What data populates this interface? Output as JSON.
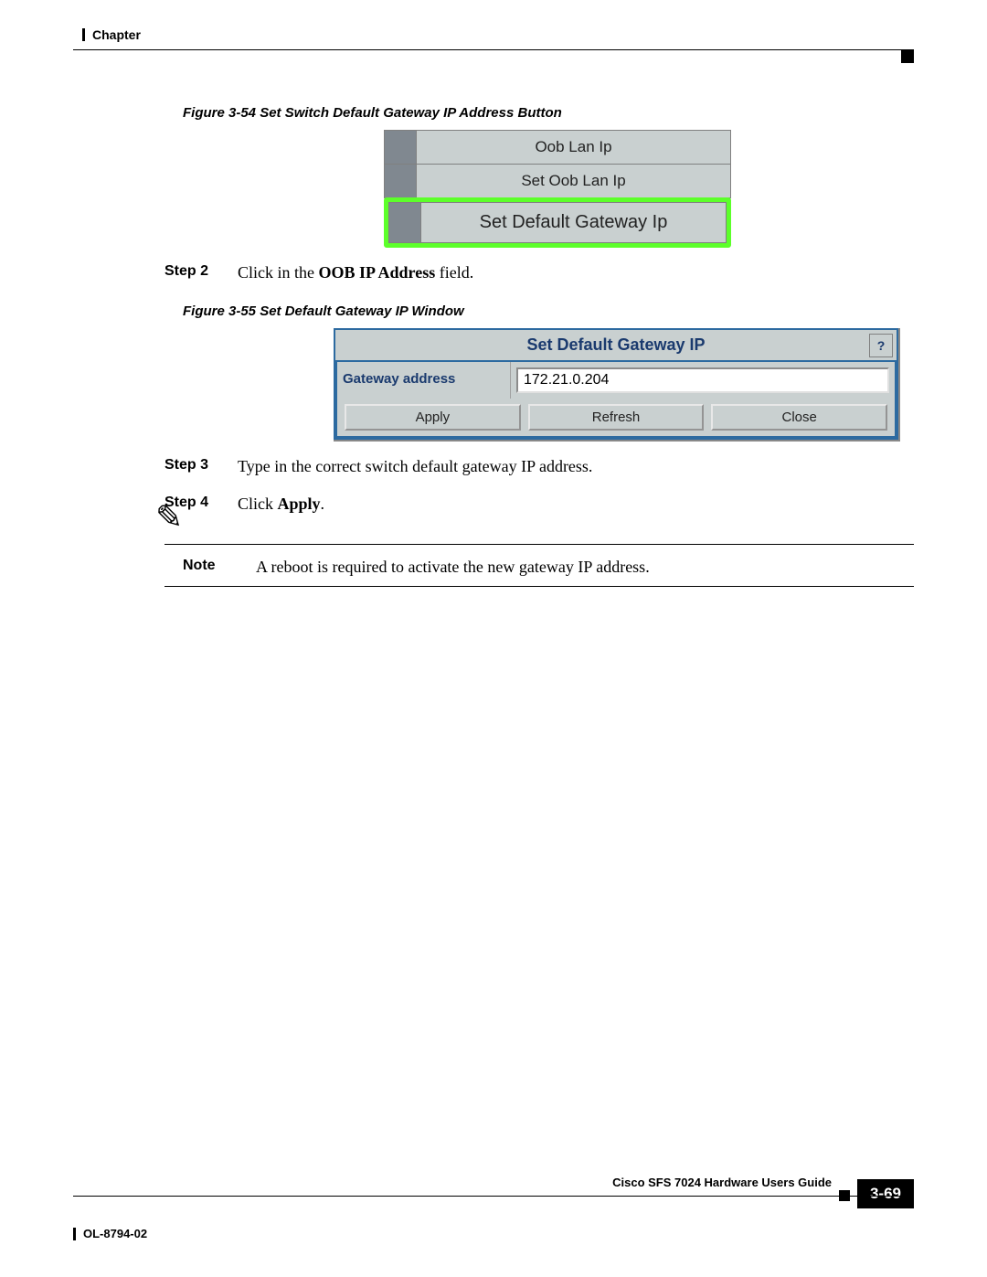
{
  "header": {
    "chapter": "Chapter"
  },
  "fig54": {
    "caption": "Figure 3-54   Set Switch Default Gateway IP Address Button",
    "btn1": "Oob Lan Ip",
    "btn2": "Set Oob Lan Ip",
    "btn3": "Set Default Gateway Ip"
  },
  "steps": {
    "s2_label": "Step 2",
    "s2_pre": "Click in the ",
    "s2_bold": "OOB IP Address",
    "s2_post": " field.",
    "s3_label": "Step 3",
    "s3_text": "Type in the correct switch default gateway IP address.",
    "s4_label": "Step 4",
    "s4_pre": "Click ",
    "s4_bold": "Apply",
    "s4_post": "."
  },
  "fig55": {
    "caption": "Figure 3-55   Set Default Gateway IP Window",
    "title": "Set Default Gateway IP",
    "help": "?",
    "field_label": "Gateway address",
    "field_value": "172.21.0.204",
    "apply": "Apply",
    "refresh": "Refresh",
    "close": "Close"
  },
  "note": {
    "label": "Note",
    "text": "A reboot is required to activate the new gateway IP address."
  },
  "footer": {
    "guide": "Cisco SFS 7024 Hardware Users Guide",
    "pagenum": "3-69",
    "docid": "OL-8794-02"
  }
}
